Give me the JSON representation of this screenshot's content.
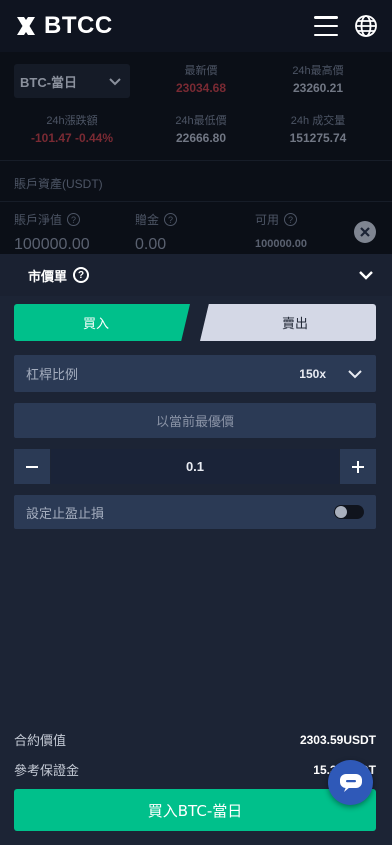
{
  "brand": {
    "name": "BTCC"
  },
  "market": {
    "symbol": "BTC-當日",
    "stats": [
      {
        "label": "最新價",
        "value": "23034.68",
        "tone": "red"
      },
      {
        "label": "24h最高價",
        "value": "23260.21",
        "tone": "gray"
      },
      {
        "label": "24h漲跌額",
        "value": "-101.47 -0.44%",
        "tone": "red"
      },
      {
        "label": "24h最低價",
        "value": "22666.80",
        "tone": "gray"
      },
      {
        "label": "24h 成交量",
        "value": "151275.74",
        "tone": "gray"
      }
    ]
  },
  "account": {
    "title": "賬戶資產(USDT)",
    "equity": {
      "label": "賬戶淨值",
      "value": "100000.00"
    },
    "bonus": {
      "label": "贈金",
      "value": "0.00"
    },
    "available": {
      "label": "可用",
      "value": "100000.00"
    }
  },
  "order": {
    "title": "市價單",
    "buy_tab": "買入",
    "sell_tab": "賣出",
    "leverage_label": "杠桿比例",
    "leverage_value": "150x",
    "price_text": "以當前最優價",
    "quantity": "0.1",
    "tpsl_label": "設定止盈止損",
    "tpsl_enabled": false,
    "contract_value_label": "合約價值",
    "contract_value": "2303.59USDT",
    "margin_label": "參考保證金",
    "margin_value": "15.36USDT",
    "submit_label": "買入BTC-當日"
  },
  "colors": {
    "buy_green": "#00c08b",
    "sell_tab": "#d4d8e6",
    "sheet_bg": "#1c2435",
    "row_bg": "#2b3a55",
    "chat_blue": "#2f59b8",
    "down_red": "#e0334f"
  }
}
